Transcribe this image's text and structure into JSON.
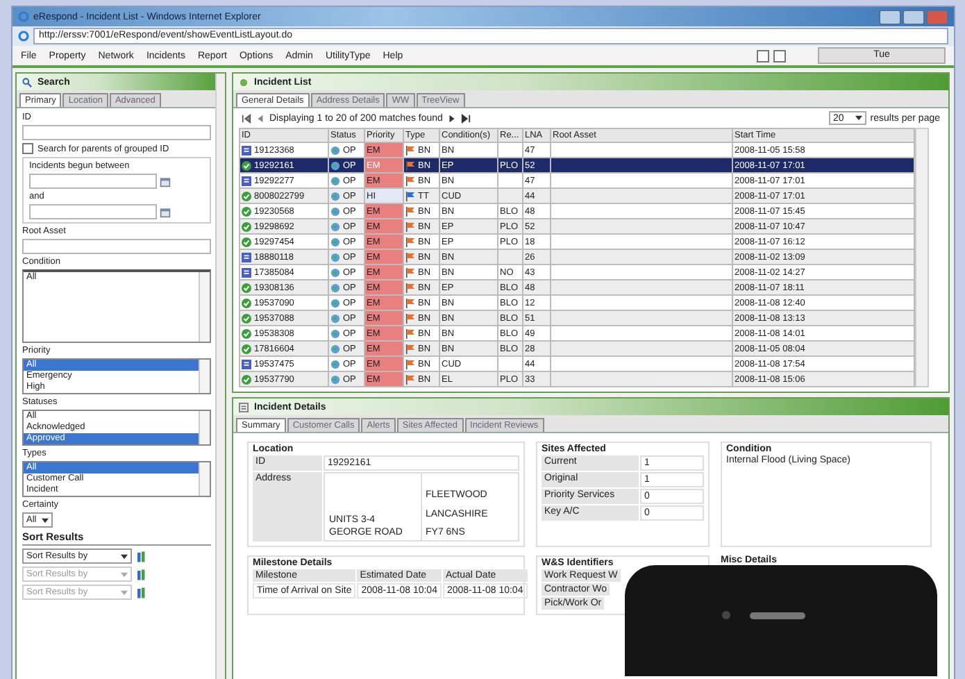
{
  "window": {
    "title": "eRespond - Incident List - Windows Internet Explorer",
    "address": "http://erssv:7001/eRespond/event/showEventListLayout.do"
  },
  "menu": [
    "File",
    "Property",
    "Network",
    "Incidents",
    "Report",
    "Options",
    "Admin",
    "UtilityType",
    "Help"
  ],
  "toolbar": {
    "label": "Tue"
  },
  "search": {
    "title": "Search",
    "tabs": [
      {
        "label": "Primary",
        "selected": true
      },
      {
        "label": "Location",
        "selected": false
      },
      {
        "label": "Advanced",
        "selected": false
      }
    ],
    "id_label": "ID",
    "parents_checkbox": {
      "label": "Search for parents of grouped ID",
      "checked": false
    },
    "date_group": {
      "title": "Incidents begun between",
      "and_label": "and"
    },
    "root_asset_label": "Root Asset",
    "condition": {
      "label": "Condition",
      "items": [
        {
          "label": "All",
          "selected": false
        }
      ]
    },
    "lists": [
      {
        "label": "Priority",
        "items": [
          {
            "label": "All",
            "selected": true
          },
          {
            "label": "Emergency",
            "selected": false
          },
          {
            "label": "High",
            "selected": false
          }
        ]
      },
      {
        "label": "Statuses",
        "items": [
          {
            "label": "All",
            "selected": false
          },
          {
            "label": "Acknowledged",
            "selected": false
          },
          {
            "label": "Approved",
            "selected": true
          }
        ]
      },
      {
        "label": "Types",
        "items": [
          {
            "label": "All",
            "selected": true
          },
          {
            "label": "Customer Call",
            "selected": false
          },
          {
            "label": "Incident",
            "selected": false
          }
        ]
      }
    ],
    "certainty": {
      "label": "Certainty",
      "value": "All"
    },
    "sort": {
      "title": "Sort Results",
      "selects": [
        {
          "value": "Sort Results by",
          "disabled": false
        },
        {
          "value": "Sort Results by",
          "disabled": true
        },
        {
          "value": "Sort Results by",
          "disabled": true
        }
      ]
    }
  },
  "incident_list": {
    "title": "Incident List",
    "tabs": [
      {
        "label": "General Details",
        "selected": true
      },
      {
        "label": "Address Details",
        "selected": false
      },
      {
        "label": "WW",
        "selected": false
      },
      {
        "label": "TreeView",
        "selected": false
      }
    ],
    "pager": {
      "text": "Displaying 1 to 20 of 200 matches found",
      "page_size": "20",
      "page_size_label": "results per page"
    },
    "columns": [
      "ID",
      "Status",
      "Priority",
      "Type",
      "Condition(s)",
      "Re...",
      "LNA",
      "Root Asset",
      "Start Time"
    ],
    "rows": [
      {
        "kind": "ticket",
        "selected": false,
        "id": "19123368",
        "status": "OP",
        "priority": {
          "text": "EM",
          "color": "#e88080"
        },
        "type": {
          "text": "BN",
          "color": "#e8702a"
        },
        "condition": "BN",
        "lna": "47",
        "start_time": "2008-11-05 15:58"
      },
      {
        "kind": "check",
        "selected": true,
        "id": "19292161",
        "status": "OP",
        "priority": {
          "text": "EM",
          "color": "#e88080"
        },
        "type": {
          "text": "BN",
          "color": "#e8702a"
        },
        "condition": "EP",
        "region": "PLO",
        "lna": "52",
        "start_time": "2008-11-07 17:01"
      },
      {
        "kind": "ticket",
        "selected": false,
        "id": "19292277",
        "status": "OP",
        "priority": {
          "text": "EM",
          "color": "#e88080"
        },
        "type": {
          "text": "BN",
          "color": "#e8702a"
        },
        "condition": "BN",
        "lna": "47",
        "start_time": "2008-11-07 17:01"
      },
      {
        "kind": "check",
        "selected": false,
        "id": "8008022799",
        "status": "OP",
        "priority": {
          "text": "HI",
          "color": "#e4e8f4"
        },
        "type": {
          "text": "TT",
          "color": "#2a70d8"
        },
        "condition": "CUD",
        "lna": "44",
        "start_time": "2008-11-07 17:01"
      },
      {
        "kind": "check",
        "selected": false,
        "id": "19230568",
        "status": "OP",
        "priority": {
          "text": "EM",
          "color": "#e88080"
        },
        "type": {
          "text": "BN",
          "color": "#e8702a"
        },
        "condition": "BN",
        "region": "BLO",
        "lna": "48",
        "start_time": "2008-11-07 15:45"
      },
      {
        "kind": "check",
        "selected": false,
        "id": "19298692",
        "status": "OP",
        "priority": {
          "text": "EM",
          "color": "#e88080"
        },
        "type": {
          "text": "BN",
          "color": "#e8702a"
        },
        "condition": "EP",
        "region": "PLO",
        "lna": "52",
        "start_time": "2008-11-07 10:47"
      },
      {
        "kind": "check",
        "selected": false,
        "id": "19297454",
        "status": "OP",
        "priority": {
          "text": "EM",
          "color": "#e88080"
        },
        "type": {
          "text": "BN",
          "color": "#e8702a"
        },
        "condition": "EP",
        "region": "PLO",
        "lna": "18",
        "start_time": "2008-11-07 16:12"
      },
      {
        "kind": "ticket",
        "selected": false,
        "id": "18880118",
        "status": "OP",
        "priority": {
          "text": "EM",
          "color": "#e88080"
        },
        "type": {
          "text": "BN",
          "color": "#e8702a"
        },
        "condition": "BN",
        "lna": "26",
        "start_time": "2008-11-02 13:09"
      },
      {
        "kind": "ticket",
        "selected": false,
        "id": "17385084",
        "status": "OP",
        "priority": {
          "text": "EM",
          "color": "#e88080"
        },
        "type": {
          "text": "BN",
          "color": "#e8702a"
        },
        "condition": "BN",
        "region": "NO",
        "lna": "43",
        "start_time": "2008-11-02 14:27"
      },
      {
        "kind": "check",
        "selected": false,
        "id": "19308136",
        "status": "OP",
        "priority": {
          "text": "EM",
          "color": "#e88080"
        },
        "type": {
          "text": "BN",
          "color": "#e8702a"
        },
        "condition": "EP",
        "region": "BLO",
        "lna": "48",
        "start_time": "2008-11-07 18:11"
      },
      {
        "kind": "check",
        "selected": false,
        "id": "19537090",
        "status": "OP",
        "priority": {
          "text": "EM",
          "color": "#e88080"
        },
        "type": {
          "text": "BN",
          "color": "#e8702a"
        },
        "condition": "BN",
        "region": "BLO",
        "lna": "12",
        "start_time": "2008-11-08 12:40"
      },
      {
        "kind": "check",
        "selected": false,
        "id": "19537088",
        "status": "OP",
        "priority": {
          "text": "EM",
          "color": "#e88080"
        },
        "type": {
          "text": "BN",
          "color": "#e8702a"
        },
        "condition": "BN",
        "region": "BLO",
        "lna": "51",
        "start_time": "2008-11-08 13:13"
      },
      {
        "kind": "check",
        "selected": false,
        "id": "19538308",
        "status": "OP",
        "priority": {
          "text": "EM",
          "color": "#e88080"
        },
        "type": {
          "text": "BN",
          "color": "#e8702a"
        },
        "condition": "BN",
        "region": "BLO",
        "lna": "49",
        "start_time": "2008-11-08 14:01"
      },
      {
        "kind": "check",
        "selected": false,
        "id": "17816604",
        "status": "OP",
        "priority": {
          "text": "EM",
          "color": "#e88080"
        },
        "type": {
          "text": "BN",
          "color": "#e8702a"
        },
        "condition": "BN",
        "region": "BLO",
        "lna": "28",
        "start_time": "2008-11-05 08:04"
      },
      {
        "kind": "ticket",
        "selected": false,
        "id": "19537475",
        "status": "OP",
        "priority": {
          "text": "EM",
          "color": "#e88080"
        },
        "type": {
          "text": "BN",
          "color": "#e8702a"
        },
        "condition": "CUD",
        "lna": "44",
        "start_time": "2008-11-08 17:54"
      },
      {
        "kind": "check",
        "selected": false,
        "id": "19537790",
        "status": "OP",
        "priority": {
          "text": "EM",
          "color": "#e88080"
        },
        "type": {
          "text": "BN",
          "color": "#e8702a"
        },
        "condition": "EL",
        "region": "PLO",
        "lna": "33",
        "start_time": "2008-11-08 15:06"
      }
    ]
  },
  "incident_details": {
    "title": "Incident Details",
    "tabs": [
      {
        "label": "Summary",
        "selected": true
      },
      {
        "label": "Customer Calls",
        "selected": false
      },
      {
        "label": "Alerts",
        "selected": false
      },
      {
        "label": "Sites Affected",
        "selected": false
      },
      {
        "label": "Incident Reviews",
        "selected": false
      }
    ],
    "location": {
      "title": "Location",
      "id_label": "ID",
      "id": "19292161",
      "address_label": "Address",
      "address_left": [
        "UNITS 3-4",
        "GEORGE ROAD"
      ],
      "address_right": [
        "FLEETWOOD",
        "LANCASHIRE",
        "FY7 6NS"
      ]
    },
    "sites_affected": {
      "title": "Sites Affected",
      "rows": [
        {
          "label": "Current",
          "value": "1"
        },
        {
          "label": "Original",
          "value": "1"
        },
        {
          "label": "Priority Services",
          "value": "0"
        },
        {
          "label": "Key A/C",
          "value": "0"
        }
      ]
    },
    "condition": {
      "title": "Condition",
      "text": "Internal Flood (Living Space)"
    },
    "milestones": {
      "title": "Milestone Details",
      "columns": [
        "Milestone",
        "Estimated Date",
        "Actual Date"
      ],
      "rows": [
        [
          "Time of Arrival on Site",
          "2008-11-08 10:04",
          "2008-11-08 10:04"
        ]
      ]
    },
    "ws_identifiers": {
      "title": "W&S Identifiers",
      "labels": [
        "Work Request W",
        "Contractor Wo",
        "Pick/Work Or"
      ]
    },
    "misc": {
      "title": "Misc Details"
    }
  }
}
